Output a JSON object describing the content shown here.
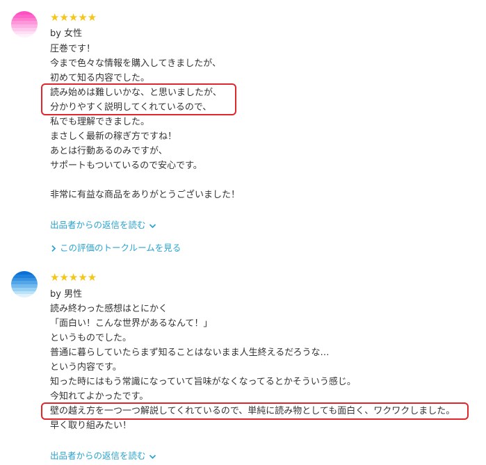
{
  "reviews": [
    {
      "avatar_colors": [
        "#ff4fc0",
        "#ff65c8",
        "#ff7dd1",
        "#ff96da",
        "#ffb0e3",
        "#ffc8ec",
        "#ffdff4",
        "#fff0fa"
      ],
      "stars": "★★★★★",
      "author": "by 女性",
      "lines": [
        "圧巻です！",
        "今まで色々な情報を購入してきましたが、",
        "初めて知る内容でした。",
        "読み始めは難しいかな、と思いましたが、",
        "分かりやすく説明してくれているので、",
        "私でも理解できました。",
        "まさしく最新の稼ぎ方ですね！",
        "あとは行動あるのみですが、",
        "サポートもついているので安心です。",
        "",
        "非常に有益な商品をありがとうございました！"
      ],
      "reply_link": "出品者からの返信を読む",
      "talkroom_link": "この評価のトークルームを見る"
    },
    {
      "avatar_colors": [
        "#0a6fd6",
        "#1f80dc",
        "#3792e2",
        "#52a6e8",
        "#72baee",
        "#96cff4",
        "#bce2f8",
        "#def1fc"
      ],
      "stars": "★★★★★",
      "author": "by 男性",
      "lines": [
        "読み終わった感想はとにかく",
        "「面白い！こんな世界があるなんて！」",
        "というものでした。",
        "普通に暮らしていたらまず知ることはないまま人生終えるだろうな…",
        "という内容です。",
        "知った時にはもう常識になっていて旨味がなくなってるとかそういう感じ。",
        "今知れてよかったです。",
        "壁の越え方を一つ一つ解説してくれているので、単純に読み物としても面白く、ワクワクしました。",
        "早く取り組みたい！"
      ],
      "reply_link": "出品者からの返信を読む"
    }
  ],
  "colors": {
    "link": "#2aa3cf",
    "star": "#f5c518",
    "highlight": "#e0262a",
    "text": "#333333"
  }
}
